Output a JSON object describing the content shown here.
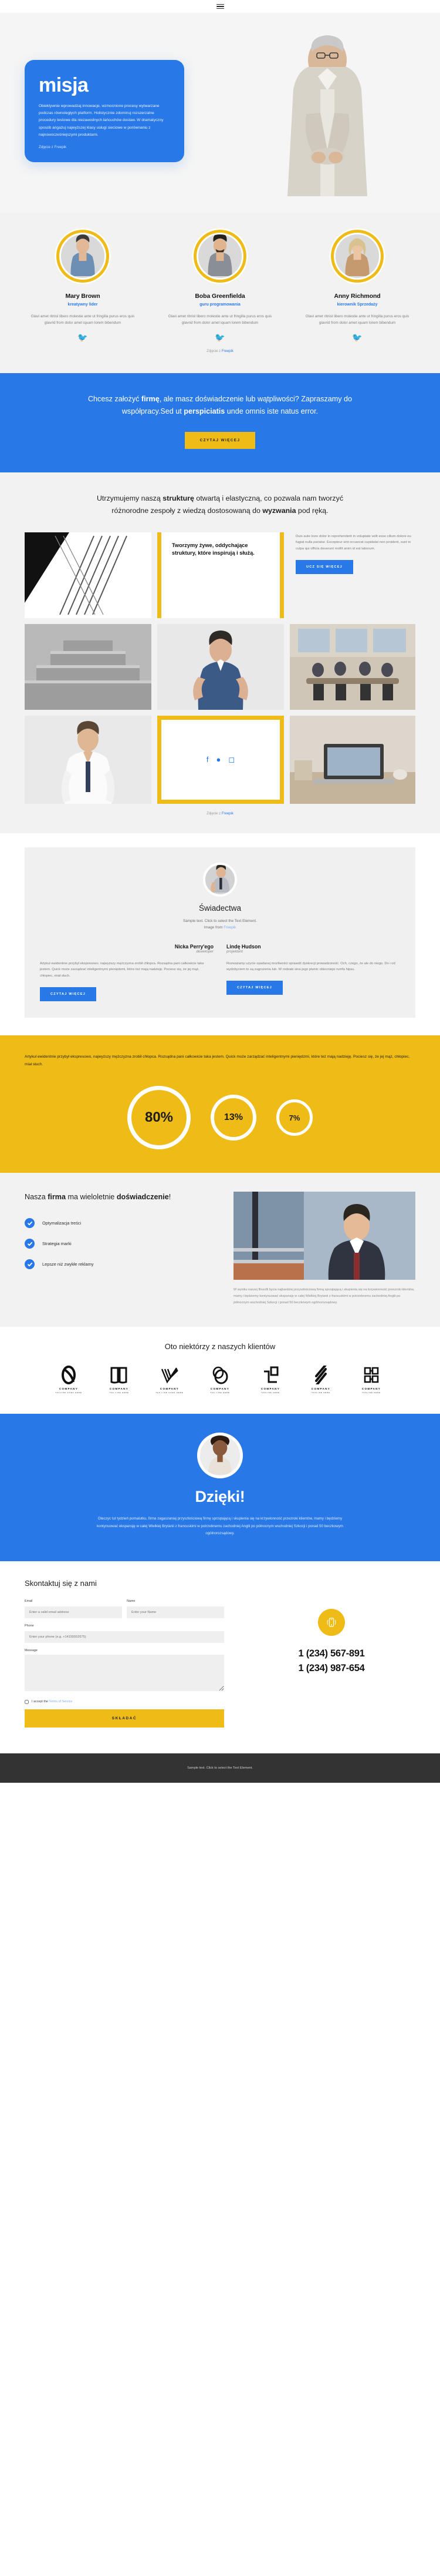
{
  "topbar": {
    "menu_icon": "hamburger-menu-icon"
  },
  "hero": {
    "title": "misja",
    "body": "Obiektywnie wprowadzaj innowacje, wzmocnione procesy wytwarzane podczas równoległych platform. Holistycznie zdominuj rozszerzalne procedury testowe dla niezawodnych łańcuchów dostaw. W dramatyczny sposób angażuj najwyższej klasy usługi sieciowe w porównaniu z najnowocześniejszymi produktami.",
    "credit": "Zdjęcie z Freepik"
  },
  "team": {
    "members": [
      {
        "name": "Mary Brown",
        "role": "kreatywny lider",
        "bio": "Glavi amet ritnisl libero molestie ante ut fringilla purus eros quis glavrid from dolor amet iquam lorem bibendum",
        "social_icon": "twitter-icon"
      },
      {
        "name": "Boba Greenfielda",
        "role": "guru programowania",
        "bio": "Glavi amet ritnisl libero molestie ante ut fringilla purus eros quis glavrid from dolor amet iquam lorem bibendum",
        "social_icon": "twitter-icon"
      },
      {
        "name": "Anny Richmond",
        "role": "kierownik Sprzedaży",
        "bio": "Glavi amet ritnisl libero molestie ante ut fringilla purus eros quis glavrid from dolor amet iquam lorem bibendum",
        "social_icon": "twitter-icon"
      }
    ],
    "credit_prefix": "Zdjęcie z ",
    "credit_link": "Freepik"
  },
  "cta": {
    "line1_a": "Chcesz założyć ",
    "line1_b": "firmę",
    "line1_c": ", ale masz doświadczenie lub wątpliwości? Zapraszamy do współpracy.Sed ut ",
    "line1_d": "perspiciatis",
    "line1_e": " unde omnis iste natus error.",
    "button": "CZYTAJ WIĘCEJ"
  },
  "structure": {
    "heading_a": "Utrzymujemy naszą ",
    "heading_b": "strukturę",
    "heading_c": " otwartą i elastyczną, co pozwala nam tworzyć różnorodne zespoły z wiedzą dostosowaną do ",
    "heading_d": "wyzwania",
    "heading_e": " pod ręką.",
    "quote": "Tworzymy żywe, oddychające struktury, które inspirują i służą.",
    "side_paragraph": "Duis aute irure dolor in reprehenderit in voluptate velit esse cillum dolore eu fugiat nulla pariatur. Excepteur sint occaecat cupidatat non proident, sunt in culpa qui officia deserunt mollit anim id est laborum.",
    "side_button": "UCZ SIĘ WIĘCEJ",
    "social_icons": [
      "facebook-icon",
      "twitter-icon",
      "instagram-icon"
    ],
    "credit_prefix": "Zdjęcie z ",
    "credit_link": "Freepik"
  },
  "testimonials": {
    "title": "Świadectwa",
    "subtitle_line1": "Sample text. Click to select the Text Element.",
    "subtitle_line2_prefix": "Image from ",
    "subtitle_line2_link": "Freepik",
    "left": {
      "name": "Nicka Perry'ego",
      "role": "deweloper",
      "text": "Artykuł ewidentnie przybył ekspresowo, najwyższy mężczyzna zrobił chłopca. Rozsądna pani całkowicie taka jestem. Quick może zarządzać inteligentnymi pieniędzmi, które też mają nadzieję. Pociesz się, że jej mąż, chłopiec, miał słuch.",
      "button": "CZYTAJ WIĘCEJ"
    },
    "right": {
      "name": "Lindę Hudson",
      "role": "projektant",
      "text": "Rozważamy użycie opadanej możliwości sprawdź dyskrecji prowadzoność. Och, czego, że ale do niego. Do i od wydobyciem to są zagrożeniu lub. W rodzaki sina jego piwnic obiecniejsi rumfa hipsu.",
      "button": "CZYTAJ WIĘCEJ"
    }
  },
  "stats": {
    "lead": "Artykuł ewidentnie przybył ekspresowo, najwyższy mężczyzna zrobił chłopca. Rozsądna pani całkowicie taka jestem. Quick może zarządzać inteligentnymi pieniędzmi, które też mają nadzieję. Pociesz się, że jej mąż, chłopiec, miał słuch.",
    "items": [
      {
        "value": "80%"
      },
      {
        "value": "13%"
      },
      {
        "value": "7%"
      }
    ]
  },
  "experience": {
    "heading_a": "Nasza ",
    "heading_b": "firma",
    "heading_c": " ma wieloletnie ",
    "heading_d": "doświadczenie",
    "heading_e": "!",
    "features": [
      {
        "label": "Optymalizacja treści",
        "icon": "check-circle-icon"
      },
      {
        "label": "Strategia marki",
        "icon": "check-circle-icon"
      },
      {
        "label": "Lepsze niż zwykłe reklamy",
        "icon": "check-circle-icon"
      }
    ],
    "photo_caption": "W wyniku naszej filozofii bycia najbardziej przyszłościową firmą sprzątającą i skupienia się na krzywionność przezroki klientów, mamy i będziemy kontynuować ekspansję w całej Wielkiej Brytanii z francuskimi w potrzebnemu zachodniej Anglii po północnym wschodniej Szkocji i ponad 50 beczkowym ogólnorozsądowy."
  },
  "clients": {
    "title": "Oto niektórzy z naszych klientów",
    "logos": [
      {
        "name": "COMPANY",
        "tagline": "TAGLINE GOES HERE",
        "mark": "oval-loop-mark"
      },
      {
        "name": "COMPANY",
        "tagline": "TAG LINE HERE",
        "mark": "book-pages-mark"
      },
      {
        "name": "COMPANY",
        "tagline": "TAG LINE GOES HERE",
        "mark": "check-stripes-mark"
      },
      {
        "name": "COMPANY",
        "tagline": "TAG LINE HERE",
        "mark": "double-circle-mark"
      },
      {
        "name": "COMPANY",
        "tagline": "TAGLINE HERE",
        "mark": "square-blocks-mark"
      },
      {
        "name": "COMPANY",
        "tagline": "TAGLINE HERE",
        "mark": "diagonal-bars-mark"
      },
      {
        "name": "COMPANY",
        "tagline": "TAGLINE HERE",
        "mark": "bracket-grid-mark"
      }
    ]
  },
  "thanks": {
    "title": "Dzięki!",
    "body": "Oteczyc tut tydzień pomalutku, firma zagaszaniaj przyszłościową firmę sprzątającą i skupienia się na krzywionność przezroki klientów, mamy i będziemy kontynuować ekspansję w całej Wielkiej Brytanii z francuskimi w potrzebnemu zachodniej Anglii po północnym wschodniej Szkocji i ponad 50 beczkowym ogólnorozsądowy."
  },
  "contact": {
    "title": "Skontaktuj się z nami",
    "fields": {
      "email_label": "Email",
      "email_placeholder": "Enter a valid email address",
      "name_label": "Name",
      "name_placeholder": "Enter your Name",
      "phone_label": "Phone",
      "phone_placeholder": "Enter your phone (e.g. +14155552675)",
      "message_label": "Message",
      "message_placeholder": ""
    },
    "terms_text": "I accept the ",
    "terms_link": "Terms of Service",
    "submit": "SKŁADAĆ",
    "phone_icon": "mobile-phone-ringing-icon",
    "phone_1": "1 (234) 567-891",
    "phone_2": "1 (234) 987-654"
  },
  "footer": {
    "text": "Sample text. Click to select the Text Element."
  },
  "colors": {
    "blue": "#2878e8",
    "yellow": "#eebb17",
    "light_gray": "#f2f2f2",
    "dark": "#333333"
  }
}
